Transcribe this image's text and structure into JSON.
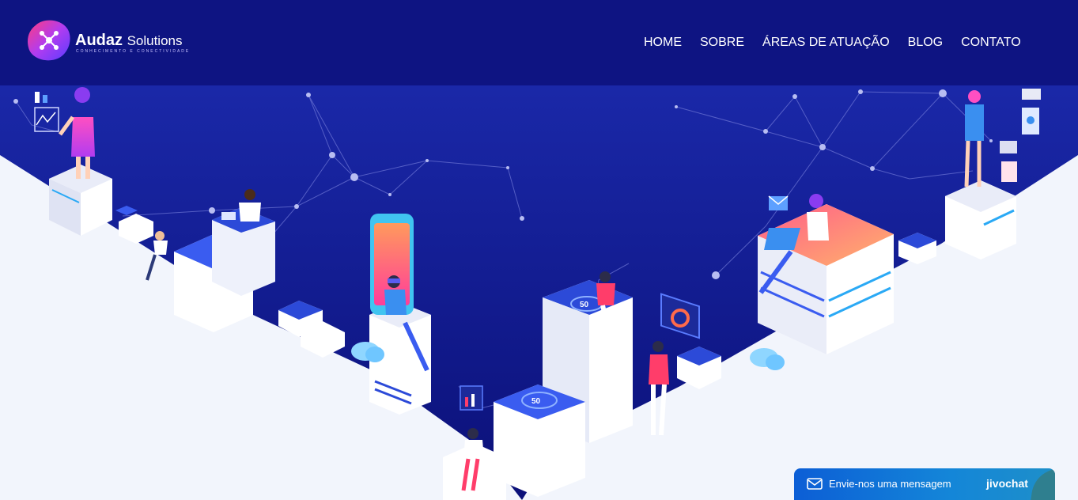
{
  "header": {
    "logo": {
      "name_bold": "Audaz",
      "name_light": "Solutions",
      "tagline": "Conhecimento e Conectividade",
      "icon": "network-nodes-icon"
    },
    "nav": [
      {
        "label": "HOME"
      },
      {
        "label": "SOBRE"
      },
      {
        "label": "ÁREAS DE ATUAÇÃO"
      },
      {
        "label": "BLOG"
      },
      {
        "label": "CONTATO"
      }
    ]
  },
  "hero": {
    "badges": [
      "50",
      "50"
    ]
  },
  "chat": {
    "label": "Envie-nos uma mensagem",
    "brand": "jivochat",
    "icon": "envelope-icon"
  },
  "colors": {
    "header_bg": "#0e1482",
    "hero_bg_dark": "#0a0f7a",
    "hero_bg_light": "#1b2fb0",
    "floor": "#f2f5fc",
    "accent_pink": "#ff3d8b",
    "accent_blue": "#3a5cf0",
    "chat_bg": "#0c5ed6"
  }
}
